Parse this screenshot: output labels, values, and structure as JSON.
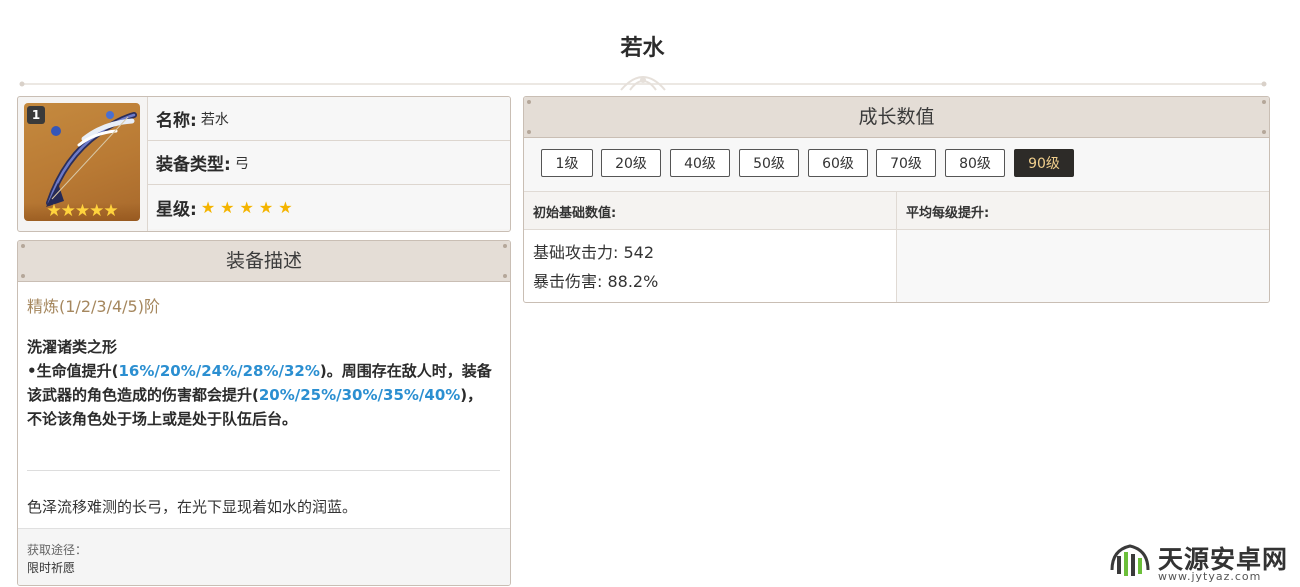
{
  "page": {
    "title": "若水"
  },
  "info": {
    "level_badge": "1",
    "name_label": "名称:",
    "name_value": "若水",
    "type_label": "装备类型:",
    "type_value": "弓",
    "rarity_label": "星级:",
    "rarity_stars": "★★★★★",
    "stars": 5
  },
  "description": {
    "header": "装备描述",
    "refinement": "精炼(1/2/3/4/5)阶",
    "skill_name": "洗濯诸类之形",
    "skill_part1": "•生命值提升(",
    "skill_value1": "16%/20%/24%/28%/32%",
    "skill_part2": ")。周围存在敌人时，装备该武器的角色造成的伤害都会提升(",
    "skill_value2": "20%/25%/30%/35%/40%",
    "skill_part3": ")，不论该角色处于场上或是处于队伍后台。",
    "flavor": "色泽流移难测的长弓，在光下显现着如水的润蓝。",
    "source_label": "获取途径：",
    "source_value": "限时祈愿"
  },
  "growth": {
    "header": "成长数值",
    "levels": [
      "1级",
      "20级",
      "40级",
      "50级",
      "60级",
      "70级",
      "80级",
      "90级"
    ],
    "selected_level": "90级",
    "base_header": "初始基础数值:",
    "avg_header": "平均每级提升:",
    "base_atk": "基础攻击力: 542",
    "crit_dmg": "暴击伤害: 88.2%"
  },
  "watermark": {
    "text": "天源安卓网",
    "url": "www.jytyaz.com"
  }
}
